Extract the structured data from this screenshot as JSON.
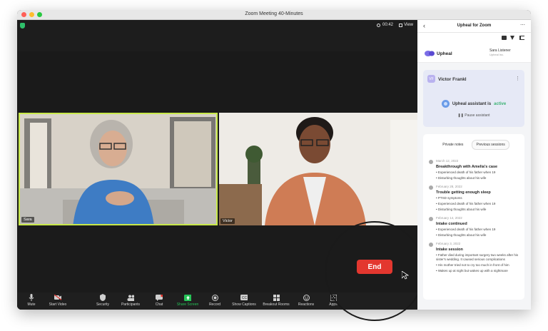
{
  "window": {
    "title": "Zoom Meeting   40-Minutes",
    "colors": {
      "close": "#ff5f57",
      "minimize": "#febc2e",
      "zoom": "#28c840"
    }
  },
  "meeting": {
    "timer": "00:42",
    "view_label": "View",
    "participants": [
      {
        "name": "Sara",
        "active": true
      },
      {
        "name": "Victor",
        "active": false
      }
    ],
    "end_label": "End",
    "accent_active_speaker": "#c8e84a"
  },
  "toolbar": {
    "items": [
      {
        "label": "Mute",
        "icon": "microphone-icon"
      },
      {
        "label": "Start Video",
        "icon": "video-off-icon"
      },
      {
        "label": "Security",
        "icon": "shield-icon"
      },
      {
        "label": "Participants",
        "icon": "participants-icon",
        "badge": "2"
      },
      {
        "label": "Chat",
        "icon": "chat-icon",
        "badge": "3"
      },
      {
        "label": "Share Screen",
        "icon": "share-screen-icon"
      },
      {
        "label": "Record",
        "icon": "record-icon"
      },
      {
        "label": "Show Captions",
        "icon": "captions-icon"
      },
      {
        "label": "Breakout Rooms",
        "icon": "breakout-rooms-icon"
      },
      {
        "label": "Reactions",
        "icon": "reactions-icon"
      },
      {
        "label": "Apps",
        "icon": "apps-icon"
      }
    ]
  },
  "panel": {
    "title": "Upheal for Zoom",
    "brand": "Upheal",
    "user_name": "Sara Listener",
    "user_sub": "Upheal Inc.",
    "client_name": "Victor Frankl",
    "client_initials": "VF",
    "assistant_prefix": "Upheal assistant is",
    "assistant_status": "active",
    "pause_label": "Pause assistant",
    "tabs": [
      "Private notes",
      "Previous sessions"
    ],
    "sessions": [
      {
        "date": "March 12, 2022",
        "title": "Breakthrough with Amelia's case",
        "bullets": [
          "Experienced death of his father when 19",
          "Disturbing thoughts about his wife"
        ]
      },
      {
        "date": "February 28, 2022",
        "title": "Trouble getting enough sleep",
        "bullets": [
          "PTSD symptoms",
          "Experienced death of his father when 19",
          "Disturbing thoughts about his wife"
        ]
      },
      {
        "date": "February 14, 2022",
        "title": "Intake continued",
        "bullets": [
          "Experienced death of his father when 19",
          "Disturbing thoughts about his wife"
        ]
      },
      {
        "date": "February 3, 2022",
        "title": "Intake session",
        "bullets": [
          "Father died during important surgery two weeks after his sister's wedding. It caused serious complications",
          "His mother tried not to cry too much in front of him",
          "Wakes up at night but wakes up with a nightmare"
        ]
      }
    ],
    "colors": {
      "active": "#3bb273",
      "card": "#e6e9f6",
      "avatar": "#b9b2ef"
    }
  }
}
